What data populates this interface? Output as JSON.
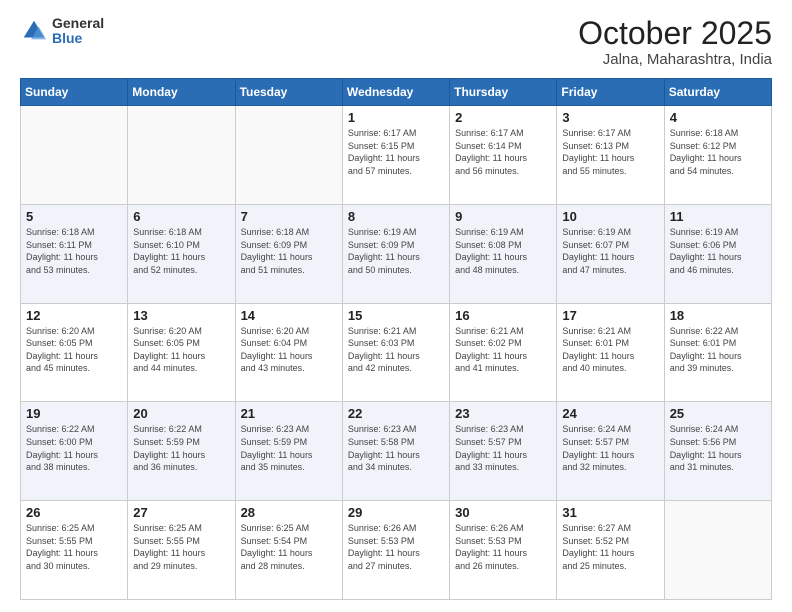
{
  "header": {
    "logo_general": "General",
    "logo_blue": "Blue",
    "title": "October 2025",
    "subtitle": "Jalna, Maharashtra, India"
  },
  "weekdays": [
    "Sunday",
    "Monday",
    "Tuesday",
    "Wednesday",
    "Thursday",
    "Friday",
    "Saturday"
  ],
  "weeks": [
    [
      {
        "day": "",
        "info": ""
      },
      {
        "day": "",
        "info": ""
      },
      {
        "day": "",
        "info": ""
      },
      {
        "day": "1",
        "info": "Sunrise: 6:17 AM\nSunset: 6:15 PM\nDaylight: 11 hours\nand 57 minutes."
      },
      {
        "day": "2",
        "info": "Sunrise: 6:17 AM\nSunset: 6:14 PM\nDaylight: 11 hours\nand 56 minutes."
      },
      {
        "day": "3",
        "info": "Sunrise: 6:17 AM\nSunset: 6:13 PM\nDaylight: 11 hours\nand 55 minutes."
      },
      {
        "day": "4",
        "info": "Sunrise: 6:18 AM\nSunset: 6:12 PM\nDaylight: 11 hours\nand 54 minutes."
      }
    ],
    [
      {
        "day": "5",
        "info": "Sunrise: 6:18 AM\nSunset: 6:11 PM\nDaylight: 11 hours\nand 53 minutes."
      },
      {
        "day": "6",
        "info": "Sunrise: 6:18 AM\nSunset: 6:10 PM\nDaylight: 11 hours\nand 52 minutes."
      },
      {
        "day": "7",
        "info": "Sunrise: 6:18 AM\nSunset: 6:09 PM\nDaylight: 11 hours\nand 51 minutes."
      },
      {
        "day": "8",
        "info": "Sunrise: 6:19 AM\nSunset: 6:09 PM\nDaylight: 11 hours\nand 50 minutes."
      },
      {
        "day": "9",
        "info": "Sunrise: 6:19 AM\nSunset: 6:08 PM\nDaylight: 11 hours\nand 48 minutes."
      },
      {
        "day": "10",
        "info": "Sunrise: 6:19 AM\nSunset: 6:07 PM\nDaylight: 11 hours\nand 47 minutes."
      },
      {
        "day": "11",
        "info": "Sunrise: 6:19 AM\nSunset: 6:06 PM\nDaylight: 11 hours\nand 46 minutes."
      }
    ],
    [
      {
        "day": "12",
        "info": "Sunrise: 6:20 AM\nSunset: 6:05 PM\nDaylight: 11 hours\nand 45 minutes."
      },
      {
        "day": "13",
        "info": "Sunrise: 6:20 AM\nSunset: 6:05 PM\nDaylight: 11 hours\nand 44 minutes."
      },
      {
        "day": "14",
        "info": "Sunrise: 6:20 AM\nSunset: 6:04 PM\nDaylight: 11 hours\nand 43 minutes."
      },
      {
        "day": "15",
        "info": "Sunrise: 6:21 AM\nSunset: 6:03 PM\nDaylight: 11 hours\nand 42 minutes."
      },
      {
        "day": "16",
        "info": "Sunrise: 6:21 AM\nSunset: 6:02 PM\nDaylight: 11 hours\nand 41 minutes."
      },
      {
        "day": "17",
        "info": "Sunrise: 6:21 AM\nSunset: 6:01 PM\nDaylight: 11 hours\nand 40 minutes."
      },
      {
        "day": "18",
        "info": "Sunrise: 6:22 AM\nSunset: 6:01 PM\nDaylight: 11 hours\nand 39 minutes."
      }
    ],
    [
      {
        "day": "19",
        "info": "Sunrise: 6:22 AM\nSunset: 6:00 PM\nDaylight: 11 hours\nand 38 minutes."
      },
      {
        "day": "20",
        "info": "Sunrise: 6:22 AM\nSunset: 5:59 PM\nDaylight: 11 hours\nand 36 minutes."
      },
      {
        "day": "21",
        "info": "Sunrise: 6:23 AM\nSunset: 5:59 PM\nDaylight: 11 hours\nand 35 minutes."
      },
      {
        "day": "22",
        "info": "Sunrise: 6:23 AM\nSunset: 5:58 PM\nDaylight: 11 hours\nand 34 minutes."
      },
      {
        "day": "23",
        "info": "Sunrise: 6:23 AM\nSunset: 5:57 PM\nDaylight: 11 hours\nand 33 minutes."
      },
      {
        "day": "24",
        "info": "Sunrise: 6:24 AM\nSunset: 5:57 PM\nDaylight: 11 hours\nand 32 minutes."
      },
      {
        "day": "25",
        "info": "Sunrise: 6:24 AM\nSunset: 5:56 PM\nDaylight: 11 hours\nand 31 minutes."
      }
    ],
    [
      {
        "day": "26",
        "info": "Sunrise: 6:25 AM\nSunset: 5:55 PM\nDaylight: 11 hours\nand 30 minutes."
      },
      {
        "day": "27",
        "info": "Sunrise: 6:25 AM\nSunset: 5:55 PM\nDaylight: 11 hours\nand 29 minutes."
      },
      {
        "day": "28",
        "info": "Sunrise: 6:25 AM\nSunset: 5:54 PM\nDaylight: 11 hours\nand 28 minutes."
      },
      {
        "day": "29",
        "info": "Sunrise: 6:26 AM\nSunset: 5:53 PM\nDaylight: 11 hours\nand 27 minutes."
      },
      {
        "day": "30",
        "info": "Sunrise: 6:26 AM\nSunset: 5:53 PM\nDaylight: 11 hours\nand 26 minutes."
      },
      {
        "day": "31",
        "info": "Sunrise: 6:27 AM\nSunset: 5:52 PM\nDaylight: 11 hours\nand 25 minutes."
      },
      {
        "day": "",
        "info": ""
      }
    ]
  ]
}
